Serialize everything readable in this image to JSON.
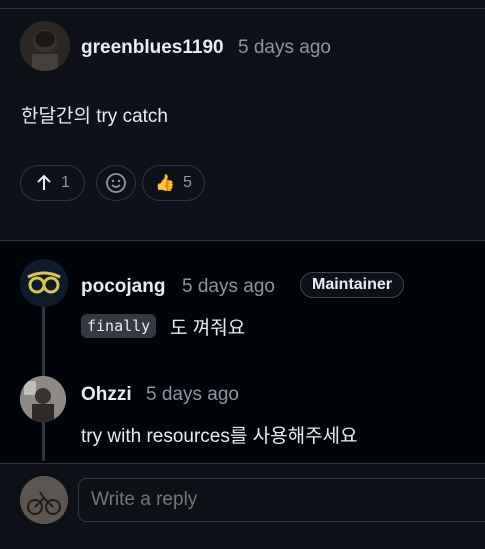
{
  "top_comment": {
    "author": "greenblues1190",
    "time": "5 days ago",
    "body": "한달간의 try catch",
    "reactions": {
      "upvote_count": "1",
      "thumbs_count": "5"
    }
  },
  "replies": [
    {
      "author": "pocojang",
      "time": "5 days ago",
      "badge": "Maintainer",
      "code": "finally",
      "body": "도 껴줘요"
    },
    {
      "author": "Ohzzi",
      "time": "5 days ago",
      "body": "try with resources를 사용해주세요"
    }
  ],
  "reply_box": {
    "placeholder": "Write a reply"
  },
  "colors": {
    "background": "#0d1117",
    "reply_background": "#010409",
    "border": "#30363d",
    "muted_text": "#8d96a0"
  },
  "icons": [
    "arrow-up-icon",
    "smiley-icon",
    "thumbs-up-icon",
    "glasses-avatar-icon"
  ]
}
